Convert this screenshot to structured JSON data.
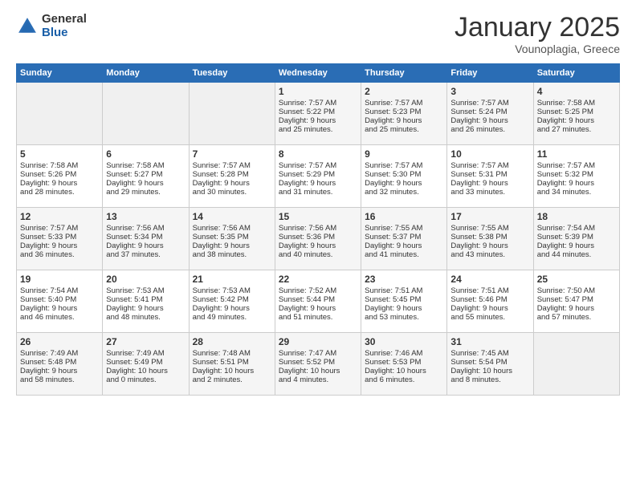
{
  "header": {
    "logo_general": "General",
    "logo_blue": "Blue",
    "title": "January 2025",
    "subtitle": "Vounoplagia, Greece"
  },
  "days_of_week": [
    "Sunday",
    "Monday",
    "Tuesday",
    "Wednesday",
    "Thursday",
    "Friday",
    "Saturday"
  ],
  "weeks": [
    [
      {
        "day": "",
        "info": ""
      },
      {
        "day": "",
        "info": ""
      },
      {
        "day": "",
        "info": ""
      },
      {
        "day": "1",
        "info": "Sunrise: 7:57 AM\nSunset: 5:22 PM\nDaylight: 9 hours\nand 25 minutes."
      },
      {
        "day": "2",
        "info": "Sunrise: 7:57 AM\nSunset: 5:23 PM\nDaylight: 9 hours\nand 25 minutes."
      },
      {
        "day": "3",
        "info": "Sunrise: 7:57 AM\nSunset: 5:24 PM\nDaylight: 9 hours\nand 26 minutes."
      },
      {
        "day": "4",
        "info": "Sunrise: 7:58 AM\nSunset: 5:25 PM\nDaylight: 9 hours\nand 27 minutes."
      }
    ],
    [
      {
        "day": "5",
        "info": "Sunrise: 7:58 AM\nSunset: 5:26 PM\nDaylight: 9 hours\nand 28 minutes."
      },
      {
        "day": "6",
        "info": "Sunrise: 7:58 AM\nSunset: 5:27 PM\nDaylight: 9 hours\nand 29 minutes."
      },
      {
        "day": "7",
        "info": "Sunrise: 7:57 AM\nSunset: 5:28 PM\nDaylight: 9 hours\nand 30 minutes."
      },
      {
        "day": "8",
        "info": "Sunrise: 7:57 AM\nSunset: 5:29 PM\nDaylight: 9 hours\nand 31 minutes."
      },
      {
        "day": "9",
        "info": "Sunrise: 7:57 AM\nSunset: 5:30 PM\nDaylight: 9 hours\nand 32 minutes."
      },
      {
        "day": "10",
        "info": "Sunrise: 7:57 AM\nSunset: 5:31 PM\nDaylight: 9 hours\nand 33 minutes."
      },
      {
        "day": "11",
        "info": "Sunrise: 7:57 AM\nSunset: 5:32 PM\nDaylight: 9 hours\nand 34 minutes."
      }
    ],
    [
      {
        "day": "12",
        "info": "Sunrise: 7:57 AM\nSunset: 5:33 PM\nDaylight: 9 hours\nand 36 minutes."
      },
      {
        "day": "13",
        "info": "Sunrise: 7:56 AM\nSunset: 5:34 PM\nDaylight: 9 hours\nand 37 minutes."
      },
      {
        "day": "14",
        "info": "Sunrise: 7:56 AM\nSunset: 5:35 PM\nDaylight: 9 hours\nand 38 minutes."
      },
      {
        "day": "15",
        "info": "Sunrise: 7:56 AM\nSunset: 5:36 PM\nDaylight: 9 hours\nand 40 minutes."
      },
      {
        "day": "16",
        "info": "Sunrise: 7:55 AM\nSunset: 5:37 PM\nDaylight: 9 hours\nand 41 minutes."
      },
      {
        "day": "17",
        "info": "Sunrise: 7:55 AM\nSunset: 5:38 PM\nDaylight: 9 hours\nand 43 minutes."
      },
      {
        "day": "18",
        "info": "Sunrise: 7:54 AM\nSunset: 5:39 PM\nDaylight: 9 hours\nand 44 minutes."
      }
    ],
    [
      {
        "day": "19",
        "info": "Sunrise: 7:54 AM\nSunset: 5:40 PM\nDaylight: 9 hours\nand 46 minutes."
      },
      {
        "day": "20",
        "info": "Sunrise: 7:53 AM\nSunset: 5:41 PM\nDaylight: 9 hours\nand 48 minutes."
      },
      {
        "day": "21",
        "info": "Sunrise: 7:53 AM\nSunset: 5:42 PM\nDaylight: 9 hours\nand 49 minutes."
      },
      {
        "day": "22",
        "info": "Sunrise: 7:52 AM\nSunset: 5:44 PM\nDaylight: 9 hours\nand 51 minutes."
      },
      {
        "day": "23",
        "info": "Sunrise: 7:51 AM\nSunset: 5:45 PM\nDaylight: 9 hours\nand 53 minutes."
      },
      {
        "day": "24",
        "info": "Sunrise: 7:51 AM\nSunset: 5:46 PM\nDaylight: 9 hours\nand 55 minutes."
      },
      {
        "day": "25",
        "info": "Sunrise: 7:50 AM\nSunset: 5:47 PM\nDaylight: 9 hours\nand 57 minutes."
      }
    ],
    [
      {
        "day": "26",
        "info": "Sunrise: 7:49 AM\nSunset: 5:48 PM\nDaylight: 9 hours\nand 58 minutes."
      },
      {
        "day": "27",
        "info": "Sunrise: 7:49 AM\nSunset: 5:49 PM\nDaylight: 10 hours\nand 0 minutes."
      },
      {
        "day": "28",
        "info": "Sunrise: 7:48 AM\nSunset: 5:51 PM\nDaylight: 10 hours\nand 2 minutes."
      },
      {
        "day": "29",
        "info": "Sunrise: 7:47 AM\nSunset: 5:52 PM\nDaylight: 10 hours\nand 4 minutes."
      },
      {
        "day": "30",
        "info": "Sunrise: 7:46 AM\nSunset: 5:53 PM\nDaylight: 10 hours\nand 6 minutes."
      },
      {
        "day": "31",
        "info": "Sunrise: 7:45 AM\nSunset: 5:54 PM\nDaylight: 10 hours\nand 8 minutes."
      },
      {
        "day": "",
        "info": ""
      }
    ]
  ]
}
